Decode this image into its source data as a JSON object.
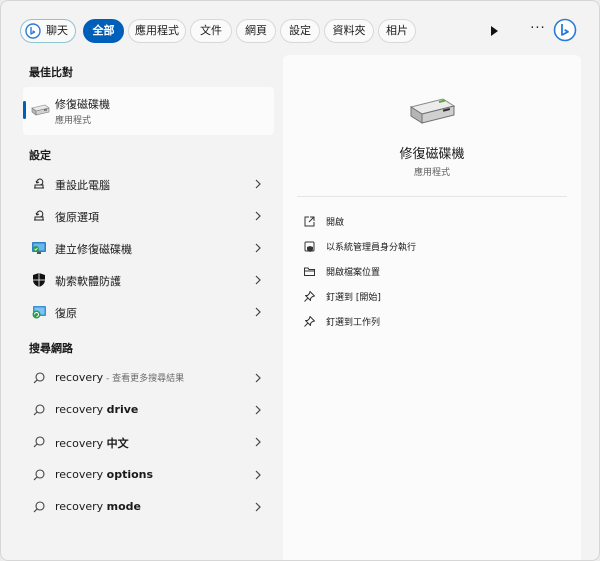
{
  "filters": {
    "chat": "聊天",
    "tabs": [
      "全部",
      "應用程式",
      "文件",
      "網頁",
      "設定",
      "資料夾",
      "相片"
    ],
    "active_index": 0,
    "more_label": "···"
  },
  "best_match": {
    "heading": "最佳比對",
    "title": "修復磁碟機",
    "subtitle": "應用程式"
  },
  "settings": {
    "heading": "設定",
    "items": [
      {
        "label": "重設此電腦",
        "icon": "reset-pc-icon"
      },
      {
        "label": "復原選項",
        "icon": "recovery-options-icon"
      },
      {
        "label": "建立修復磁碟機",
        "icon": "recovery-drive-monitor-icon"
      },
      {
        "label": "勒索軟體防護",
        "icon": "shield-icon"
      },
      {
        "label": "復原",
        "icon": "restore-icon"
      }
    ]
  },
  "web": {
    "heading": "搜尋網路",
    "items": [
      {
        "query": "recovery",
        "suffix": " - 查看更多搜尋結果",
        "bold": ""
      },
      {
        "query": "recovery ",
        "suffix": "",
        "bold": "drive"
      },
      {
        "query": "recovery ",
        "suffix": "",
        "bold": "中文"
      },
      {
        "query": "recovery ",
        "suffix": "",
        "bold": "options"
      },
      {
        "query": "recovery ",
        "suffix": "",
        "bold": "mode"
      }
    ]
  },
  "detail": {
    "app_name": "修復磁碟機",
    "app_type": "應用程式",
    "actions": [
      {
        "label": "開啟",
        "icon": "open-icon"
      },
      {
        "label": "以系統管理員身分執行",
        "icon": "admin-shield-icon"
      },
      {
        "label": "開啟檔案位置",
        "icon": "folder-icon"
      },
      {
        "label": "釘選到 [開始]",
        "icon": "pin-icon"
      },
      {
        "label": "釘選到工作列",
        "icon": "pin-icon"
      }
    ]
  },
  "colors": {
    "accent": "#005fb8",
    "background": "#f3f3f3",
    "panel": "#fbfbfb"
  }
}
